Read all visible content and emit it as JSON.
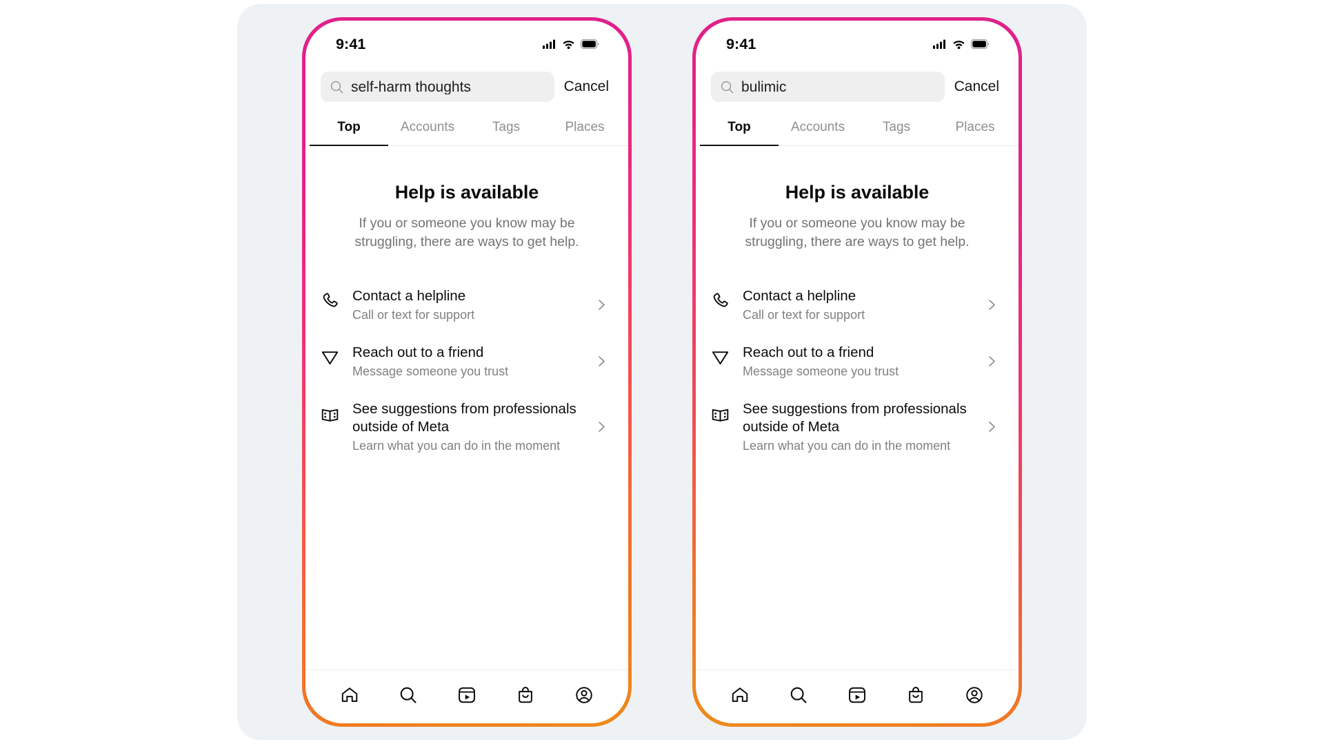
{
  "app": {
    "name": "Instagram Search",
    "backdrop_color": "#eef2f5",
    "frame_gradient": [
      "#e0218a",
      "#f26a36",
      "#ee8b1b"
    ]
  },
  "phones": [
    {
      "status_bar": {
        "time": "9:41",
        "icons": [
          "cellular-signal-icon",
          "wifi-icon",
          "battery-icon"
        ]
      },
      "search": {
        "icon": "search-icon",
        "value": "self-harm thoughts",
        "placeholder": "Search",
        "cancel_label": "Cancel"
      },
      "tabs": [
        {
          "label": "Top",
          "active": true
        },
        {
          "label": "Accounts",
          "active": false
        },
        {
          "label": "Tags",
          "active": false
        },
        {
          "label": "Places",
          "active": false
        }
      ],
      "help": {
        "title": "Help is available",
        "subtitle": "If you or someone you know may be struggling, there are ways to get help."
      },
      "options": [
        {
          "icon": "phone-icon",
          "title": "Contact a helpline",
          "subtitle": "Call or text for support",
          "chevron": "chevron-right-icon"
        },
        {
          "icon": "send-icon",
          "title": "Reach out to a friend",
          "subtitle": "Message someone you trust",
          "chevron": "chevron-right-icon"
        },
        {
          "icon": "brochure-icon",
          "title": "See suggestions from professionals outside of Meta",
          "subtitle": "Learn what you can do in the moment",
          "chevron": "chevron-right-icon"
        }
      ],
      "bottom_nav": [
        "home-icon",
        "search-icon",
        "reels-icon",
        "shop-icon",
        "profile-icon"
      ]
    },
    {
      "status_bar": {
        "time": "9:41",
        "icons": [
          "cellular-signal-icon",
          "wifi-icon",
          "battery-icon"
        ]
      },
      "search": {
        "icon": "search-icon",
        "value": "bulimic",
        "placeholder": "Search",
        "cancel_label": "Cancel"
      },
      "tabs": [
        {
          "label": "Top",
          "active": true
        },
        {
          "label": "Accounts",
          "active": false
        },
        {
          "label": "Tags",
          "active": false
        },
        {
          "label": "Places",
          "active": false
        }
      ],
      "help": {
        "title": "Help is available",
        "subtitle": "If you or someone you know may be struggling, there are ways to get help."
      },
      "options": [
        {
          "icon": "phone-icon",
          "title": "Contact a helpline",
          "subtitle": "Call or text for support",
          "chevron": "chevron-right-icon"
        },
        {
          "icon": "send-icon",
          "title": "Reach out to a friend",
          "subtitle": "Message someone you trust",
          "chevron": "chevron-right-icon"
        },
        {
          "icon": "brochure-icon",
          "title": "See suggestions from professionals outside of Meta",
          "subtitle": "Learn what you can do in the moment",
          "chevron": "chevron-right-icon"
        }
      ],
      "bottom_nav": [
        "home-icon",
        "search-icon",
        "reels-icon",
        "shop-icon",
        "profile-icon"
      ]
    }
  ]
}
